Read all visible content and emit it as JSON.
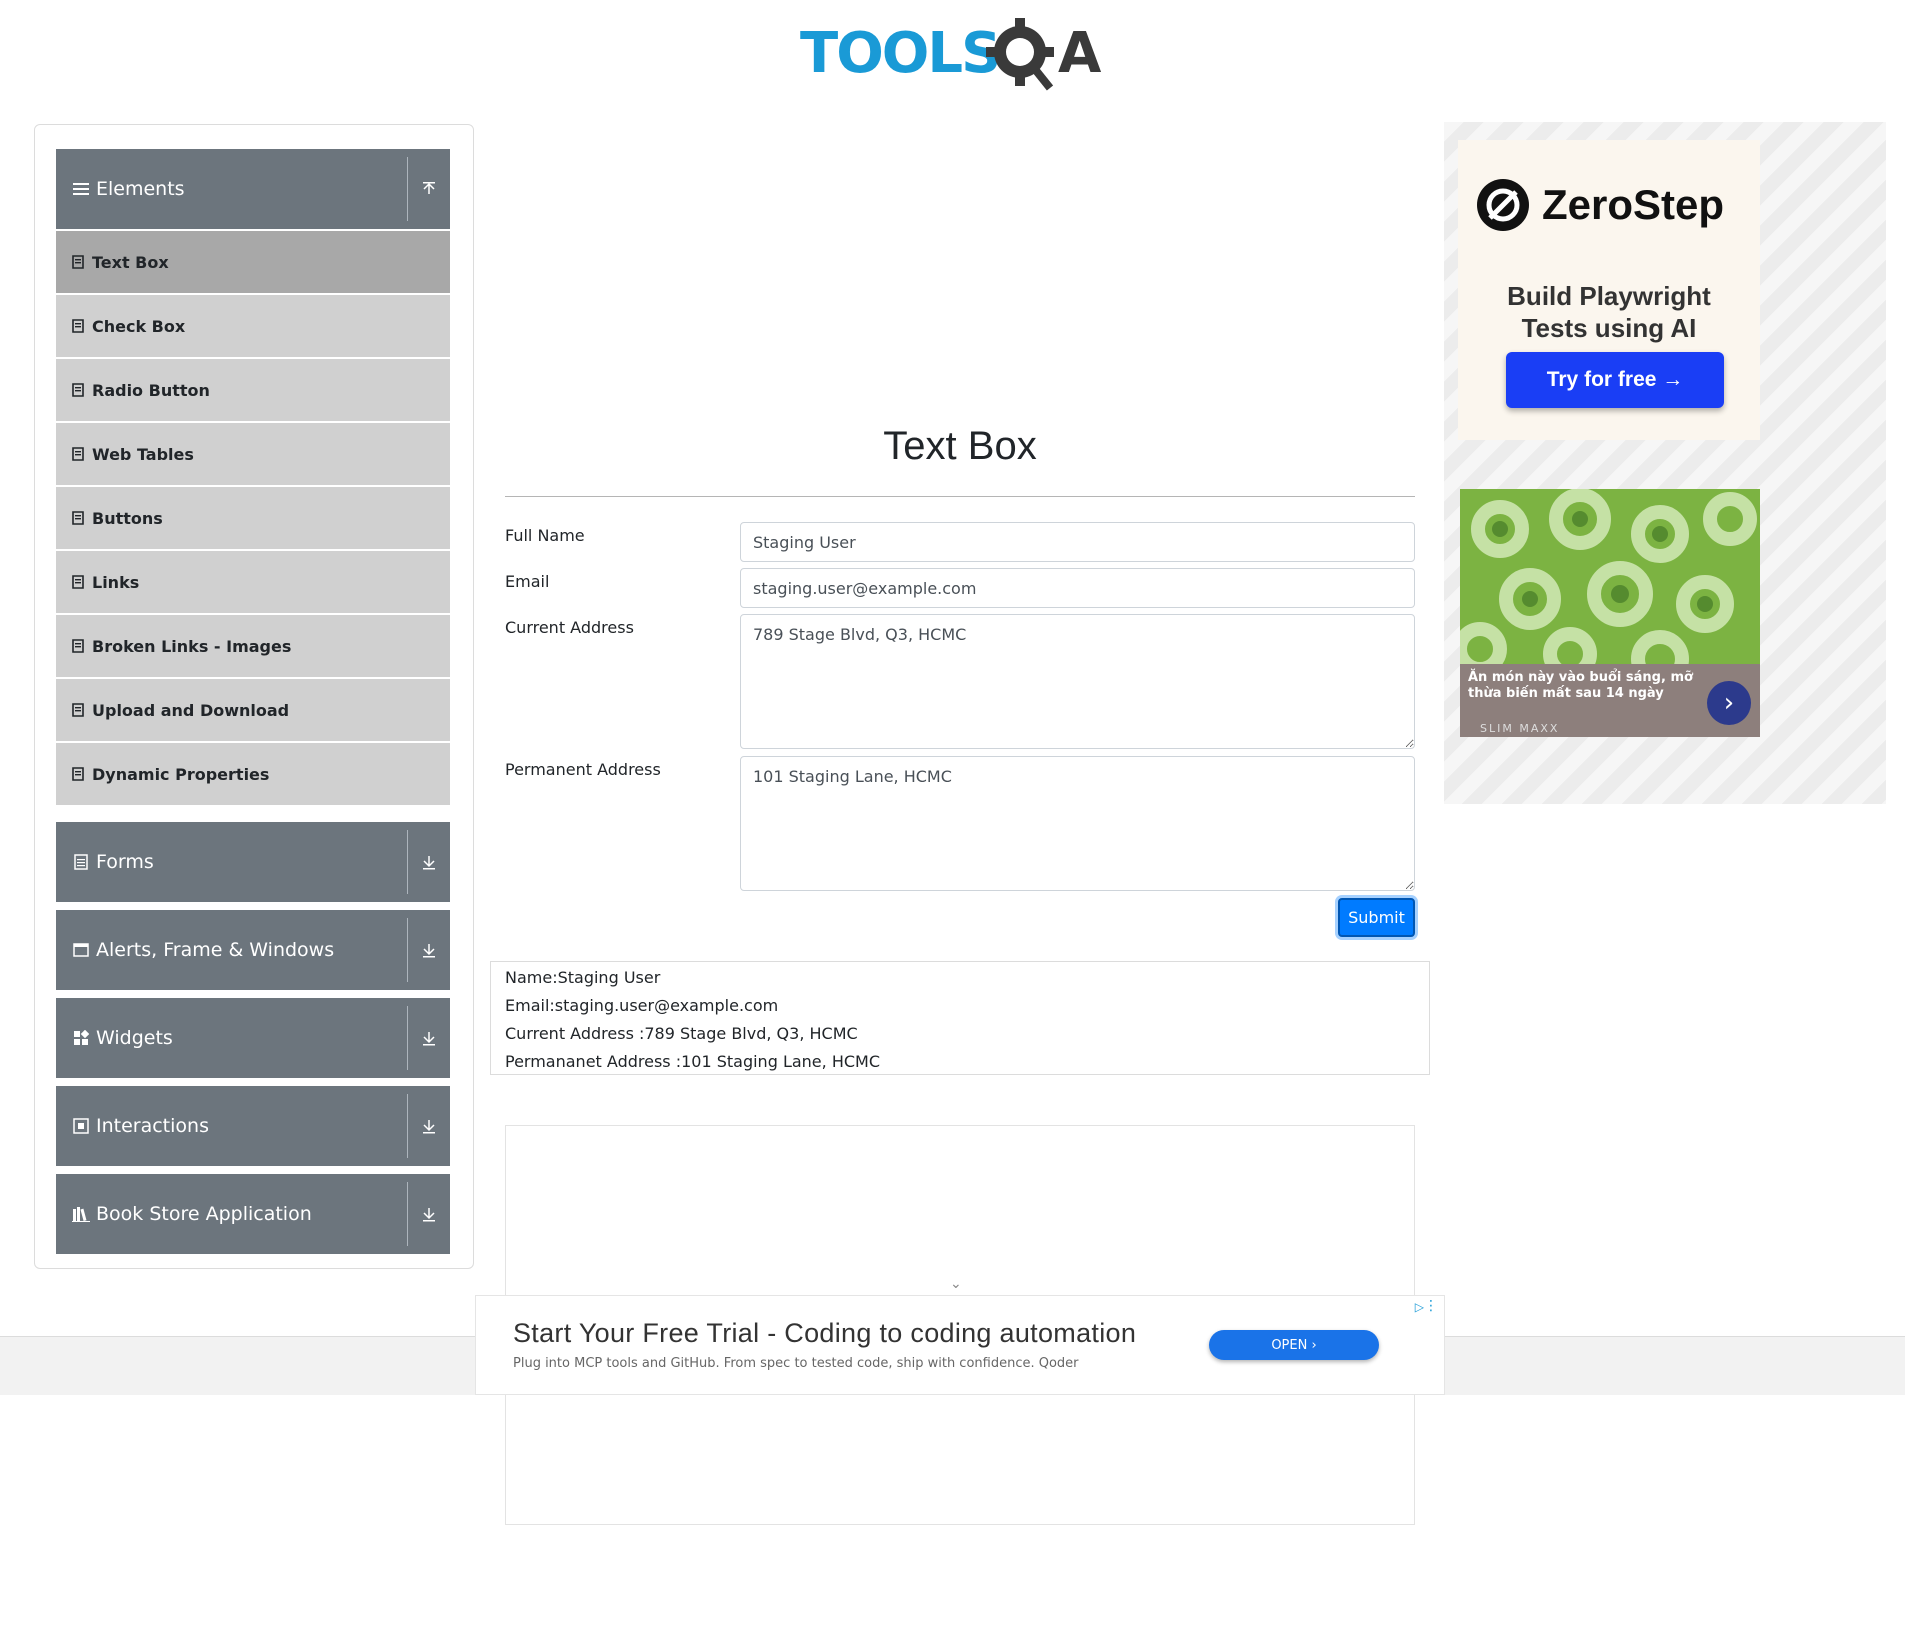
{
  "header": {
    "logo_text": "TOOLSQA"
  },
  "sidebar": {
    "groups": [
      {
        "label": "Elements",
        "icon": "menu-icon",
        "expanded": true
      },
      {
        "label": "Forms",
        "icon": "form-icon"
      },
      {
        "label": "Alerts, Frame & Windows",
        "icon": "window-icon"
      },
      {
        "label": "Widgets",
        "icon": "widgets-icon"
      },
      {
        "label": "Interactions",
        "icon": "interactions-icon"
      },
      {
        "label": "Book Store Application",
        "icon": "bookstore-icon"
      }
    ],
    "items": [
      {
        "label": "Text Box",
        "active": true
      },
      {
        "label": "Check Box"
      },
      {
        "label": "Radio Button"
      },
      {
        "label": "Web Tables"
      },
      {
        "label": "Buttons"
      },
      {
        "label": "Links"
      },
      {
        "label": "Broken Links - Images"
      },
      {
        "label": "Upload and Download"
      },
      {
        "label": "Dynamic Properties"
      }
    ]
  },
  "main": {
    "title": "Text Box",
    "form": {
      "full_name_label": "Full Name",
      "full_name_value": "Staging User",
      "email_label": "Email",
      "email_value": "staging.user@example.com",
      "current_address_label": "Current Address",
      "current_address_value": "789 Stage Blvd, Q3, HCMC",
      "permanent_address_label": "Permanent Address",
      "permanent_address_value": "101 Staging Lane, HCMC",
      "submit_label": "Submit"
    },
    "output": {
      "name": "Name:Staging User",
      "email": "Email:staging.user@example.com",
      "current_address": "Current Address :789 Stage Blvd, Q3, HCMC",
      "permanent_address": "Permananet Address :101 Staging Lane, HCMC"
    }
  },
  "ads": {
    "zerostep": {
      "brand": "ZeroStep",
      "tagline_1": "Build Playwright",
      "tagline_2": "Tests using AI",
      "cta": "Try for free →"
    },
    "slim": {
      "caption": "Ăn món này vào buổi sáng, mỡ thừa biến mất sau 14 ngày",
      "brand": "SLIM MAXX"
    },
    "bottom": {
      "title": "Start Your Free Trial - Coding to coding automation",
      "subtitle": "Plug into MCP tools and GitHub. From spec to tested code, ship with confidence. Qoder",
      "cta": "OPEN"
    }
  },
  "colors": {
    "accent_blue": "#007bff",
    "sidebar_header": "#6c757d",
    "sidebar_item": "#d0d0d0",
    "sidebar_item_active": "#a8a8a8",
    "logo_blue": "#1a9ad6",
    "logo_dark": "#3a3a3a"
  }
}
